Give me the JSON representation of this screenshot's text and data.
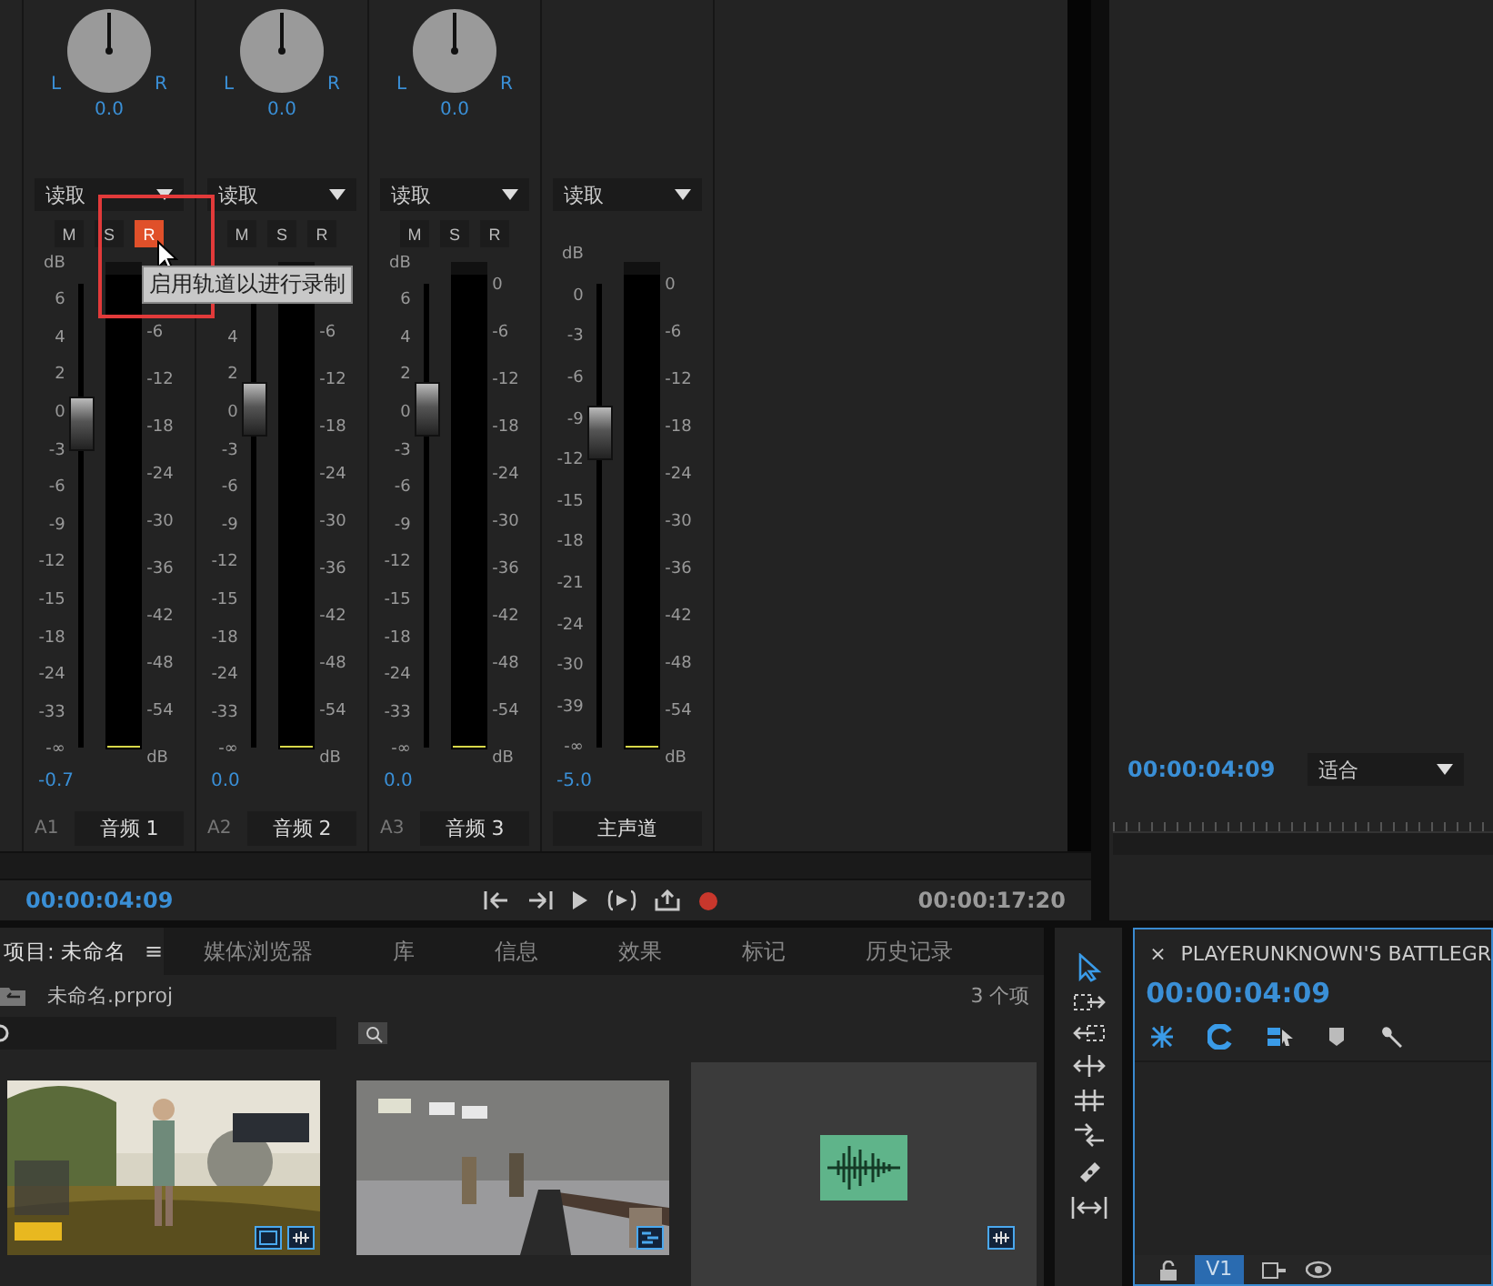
{
  "mixer": {
    "channels": [
      {
        "kind": "track",
        "pan": {
          "left": "L",
          "right": "R",
          "reading": "0.0"
        },
        "automation": "读取",
        "buttons": [
          {
            "label": "M",
            "on": false
          },
          {
            "label": "S",
            "on": false
          },
          {
            "label": "R",
            "on": true
          }
        ],
        "fader_scale": [
          "dB",
          "6",
          "4",
          "2",
          "0",
          "-3",
          "-6",
          "-9",
          "-12",
          "-15",
          "-18",
          "-24",
          "-33",
          "-∞"
        ],
        "meter_scale": [
          "-6",
          "-12",
          "-18",
          "-24",
          "-30",
          "-36",
          "-42",
          "-48",
          "-54",
          "dB"
        ],
        "fader": {
          "level": 0.7
        },
        "reading": "-0.7",
        "track_id": "A1",
        "name": "音频 1"
      },
      {
        "kind": "track",
        "pan": {
          "left": "L",
          "right": "R",
          "reading": "0.0"
        },
        "automation": "读取",
        "buttons": [
          {
            "label": "M",
            "on": false
          },
          {
            "label": "S",
            "on": false
          },
          {
            "label": "R",
            "on": false
          }
        ],
        "fader_scale": [
          "4",
          "2",
          "0",
          "-3",
          "-6",
          "-9",
          "-12",
          "-15",
          "-18",
          "-24",
          "-33",
          "-∞"
        ],
        "meter_scale": [
          "-6",
          "-12",
          "-18",
          "-24",
          "-30",
          "-36",
          "-42",
          "-48",
          "-54",
          "dB"
        ],
        "fader": {
          "level": 0.73
        },
        "reading": "0.0",
        "track_id": "A2",
        "name": "音频 2"
      },
      {
        "kind": "track",
        "pan": {
          "left": "L",
          "right": "R",
          "reading": "0.0"
        },
        "automation": "读取",
        "buttons": [
          {
            "label": "M",
            "on": false
          },
          {
            "label": "S",
            "on": false
          },
          {
            "label": "R",
            "on": false
          }
        ],
        "fader_scale": [
          "dB",
          "6",
          "4",
          "2",
          "0",
          "-3",
          "-6",
          "-9",
          "-12",
          "-15",
          "-18",
          "-24",
          "-33",
          "-∞"
        ],
        "meter_scale": [
          "0",
          "-6",
          "-12",
          "-18",
          "-24",
          "-30",
          "-36",
          "-42",
          "-48",
          "-54",
          "dB"
        ],
        "fader": {
          "level": 0.73
        },
        "reading": "0.0",
        "track_id": "A3",
        "name": "音频 3"
      },
      {
        "kind": "master",
        "automation": "读取",
        "fader_scale": [
          "dB",
          "0",
          "-3",
          "-6",
          "-9",
          "-12",
          "-15",
          "-18",
          "-21",
          "-24",
          "-30",
          "-39",
          "-∞"
        ],
        "meter_scale": [
          "0",
          "-6",
          "-12",
          "-18",
          "-24",
          "-30",
          "-36",
          "-42",
          "-48",
          "-54",
          "dB"
        ],
        "fader": {
          "level": 0.68
        },
        "reading": "-5.0",
        "name": "主声道"
      }
    ],
    "tooltip": "启用轨道以进行录制",
    "transport": {
      "current": "00:00:04:09",
      "duration": "00:00:17:20"
    }
  },
  "monitor": {
    "timecode": "00:00:04:09",
    "zoom": "适合"
  },
  "project": {
    "tabs": [
      {
        "label": "项目: 未命名",
        "selected": true
      },
      {
        "label": "媒体浏览器",
        "selected": false
      },
      {
        "label": "库",
        "selected": false
      },
      {
        "label": "信息",
        "selected": false
      },
      {
        "label": "效果",
        "selected": false
      },
      {
        "label": "标记",
        "selected": false
      },
      {
        "label": "历史记录",
        "selected": false
      }
    ],
    "menu": "≡",
    "file": "未命名.prproj",
    "count": "3 个项",
    "items": [
      {
        "kind": "video",
        "selected": false
      },
      {
        "kind": "sequence",
        "selected": false
      },
      {
        "kind": "audio",
        "selected": true
      }
    ]
  },
  "timeline": {
    "close": "×",
    "title": "PLAYERUNKNOWN'S BATTLEGR",
    "timecode": "00:00:04:09",
    "track": "V1"
  }
}
